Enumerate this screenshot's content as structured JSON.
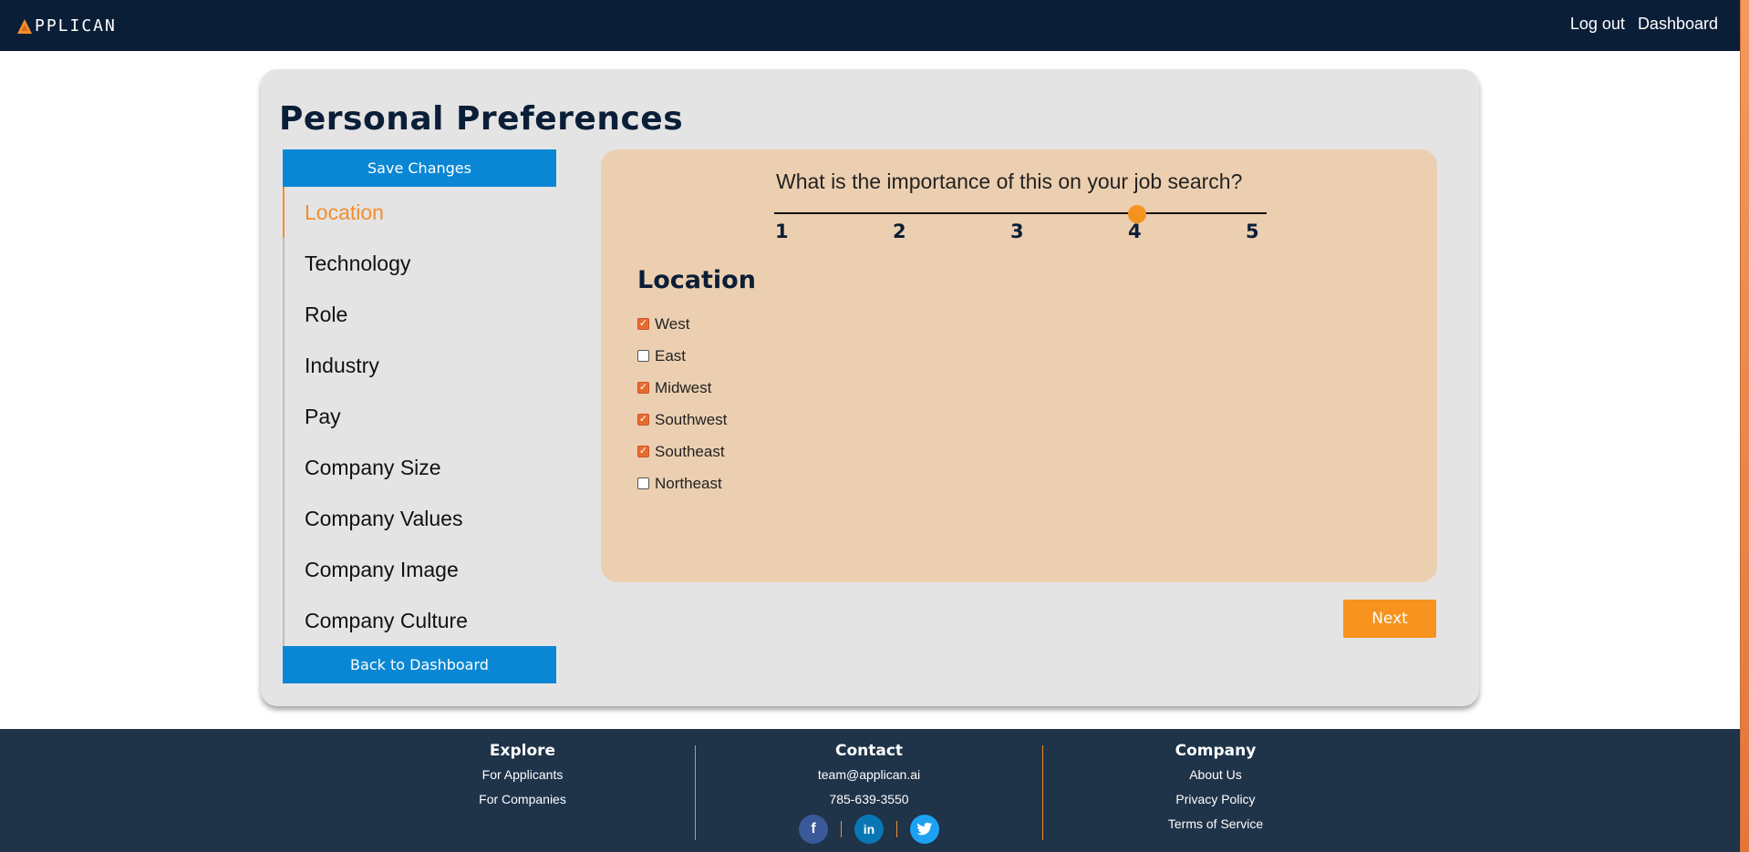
{
  "header": {
    "logo_text": "PPLICAN",
    "nav": [
      "Log out",
      "Dashboard"
    ]
  },
  "page": {
    "title": "Personal Preferences",
    "save_label": "Save Changes",
    "back_label": "Back to Dashboard",
    "next_label": "Next"
  },
  "sidebar": {
    "items": [
      {
        "label": "Location",
        "active": true
      },
      {
        "label": "Technology"
      },
      {
        "label": "Role"
      },
      {
        "label": "Industry"
      },
      {
        "label": "Pay"
      },
      {
        "label": "Company Size"
      },
      {
        "label": "Company Values"
      },
      {
        "label": "Company Image"
      },
      {
        "label": "Company Culture"
      }
    ]
  },
  "importance": {
    "question": "What is the importance of this on your job search?",
    "ticks": [
      "1",
      "2",
      "3",
      "4",
      "5"
    ],
    "value": 4
  },
  "location": {
    "title": "Location",
    "options": [
      {
        "label": "West",
        "checked": true
      },
      {
        "label": "East",
        "checked": false
      },
      {
        "label": "Midwest",
        "checked": true
      },
      {
        "label": "Southwest",
        "checked": true
      },
      {
        "label": "Southeast",
        "checked": true
      },
      {
        "label": "Northeast",
        "checked": false
      }
    ]
  },
  "footer": {
    "explore": {
      "title": "Explore",
      "links": [
        "For Applicants",
        "For Companies"
      ]
    },
    "contact": {
      "title": "Contact",
      "email": "team@applican.ai",
      "phone": "785-639-3550"
    },
    "company": {
      "title": "Company",
      "links": [
        "About Us",
        "Privacy Policy",
        "Terms of Service"
      ]
    },
    "social": [
      "facebook-icon",
      "linkedin-icon",
      "twitter-icon"
    ]
  },
  "colors": {
    "nav_bg": "#0b1e37",
    "accent_orange": "#f38f2c",
    "button_blue": "#0a87d4",
    "panel_bg": "#eccfb0",
    "footer_bg": "#1f3349"
  }
}
